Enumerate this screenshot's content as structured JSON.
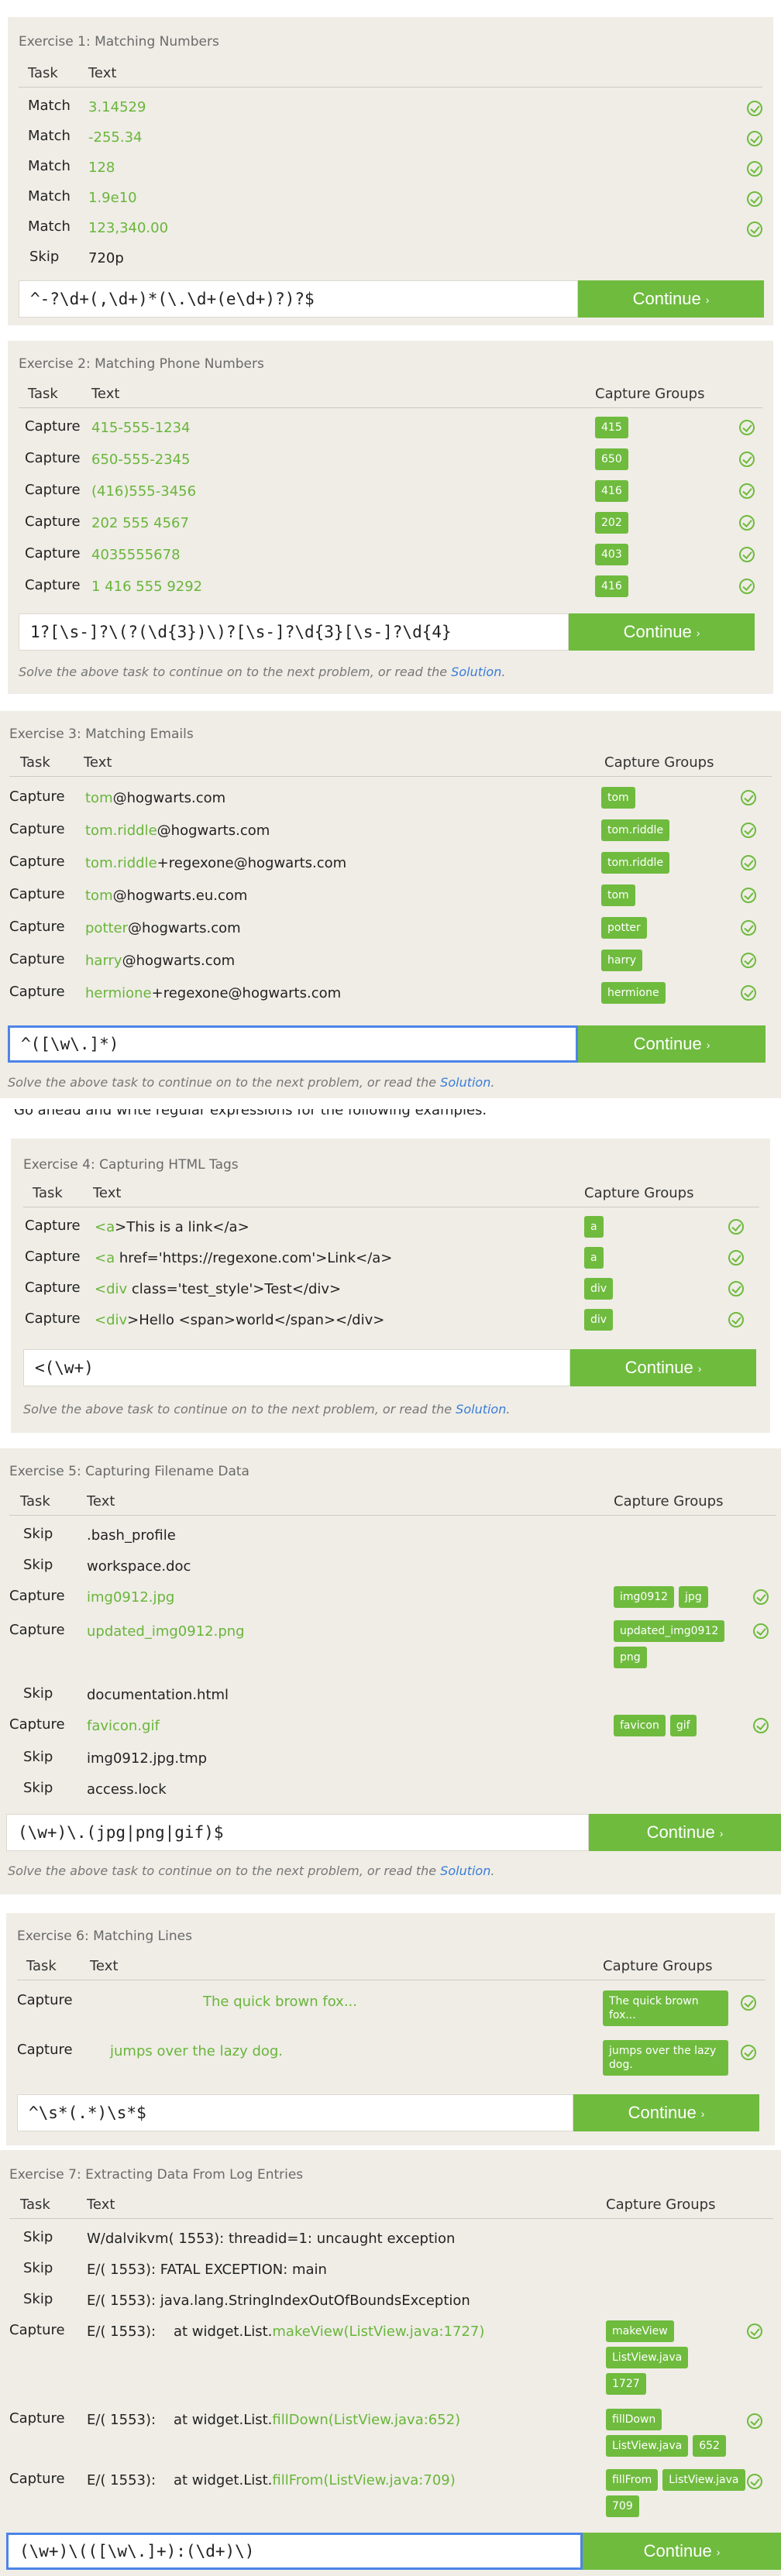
{
  "headers": {
    "task": "Task",
    "text": "Text",
    "capture_groups": "Capture Groups"
  },
  "continue_label": "Continue",
  "continue_arrow": "›",
  "solve_prefix": "Solve the above task to continue on to the next problem, or read the ",
  "solve_link": "Solution",
  "solve_suffix": ".",
  "intro_text": "Go ahead and write regular expressions for the following examples.",
  "colors": {
    "accent": "#6fbb3e",
    "panel": "#efede6",
    "link": "#3b7dd8",
    "focus": "#4d84e8"
  },
  "ex1": {
    "title": "Exercise 1: Matching Numbers",
    "regex": "^-?\\d+(,\\d+)*(\\.\\d+(e\\d+)?)?$",
    "rows": [
      {
        "task": "Match",
        "text": "3.14529"
      },
      {
        "task": "Match",
        "text": "-255.34"
      },
      {
        "task": "Match",
        "text": "128"
      },
      {
        "task": "Match",
        "text": "1.9e10"
      },
      {
        "task": "Match",
        "text": "123,340.00"
      },
      {
        "task": "Skip",
        "text": "720p"
      }
    ]
  },
  "ex2": {
    "title": "Exercise 2: Matching Phone Numbers",
    "regex": "1?[\\s-]?\\(?(\\d{3})\\)?[\\s-]?\\d{3}[\\s-]?\\d{4}",
    "rows": [
      {
        "task": "Capture",
        "text": "415-555-1234",
        "groups": [
          "415"
        ]
      },
      {
        "task": "Capture",
        "text": "650-555-2345",
        "groups": [
          "650"
        ]
      },
      {
        "task": "Capture",
        "text": "(416)555-3456",
        "groups": [
          "416"
        ]
      },
      {
        "task": "Capture",
        "text": "202 555 4567",
        "groups": [
          "202"
        ]
      },
      {
        "task": "Capture",
        "text": "4035555678",
        "groups": [
          "403"
        ]
      },
      {
        "task": "Capture",
        "text": "1 416 555 9292",
        "groups": [
          "416"
        ]
      }
    ]
  },
  "ex3": {
    "title": "Exercise 3: Matching Emails",
    "regex": "^([\\w\\.]*)",
    "rows": [
      {
        "task": "Capture",
        "hl": "tom",
        "rest": "@hogwarts.com",
        "groups": [
          "tom"
        ]
      },
      {
        "task": "Capture",
        "hl": "tom.riddle",
        "rest": "@hogwarts.com",
        "groups": [
          "tom.riddle"
        ]
      },
      {
        "task": "Capture",
        "hl": "tom.riddle",
        "rest": "+regexone@hogwarts.com",
        "groups": [
          "tom.riddle"
        ]
      },
      {
        "task": "Capture",
        "hl": "tom",
        "rest": "@hogwarts.eu.com",
        "groups": [
          "tom"
        ]
      },
      {
        "task": "Capture",
        "hl": "potter",
        "rest": "@hogwarts.com",
        "groups": [
          "potter"
        ]
      },
      {
        "task": "Capture",
        "hl": "harry",
        "rest": "@hogwarts.com",
        "groups": [
          "harry"
        ]
      },
      {
        "task": "Capture",
        "hl": "hermione",
        "rest": "+regexone@hogwarts.com",
        "groups": [
          "hermione"
        ]
      }
    ]
  },
  "ex4": {
    "title": "Exercise 4: Capturing HTML Tags",
    "regex": "<(\\w+)",
    "rows": [
      {
        "task": "Capture",
        "hl": "<a",
        "rest": ">This is a link</a>",
        "groups": [
          "a"
        ]
      },
      {
        "task": "Capture",
        "hl": "<a",
        "rest": " href='https://regexone.com'>Link</a>",
        "groups": [
          "a"
        ]
      },
      {
        "task": "Capture",
        "hl": "<div",
        "rest": " class='test_style'>Test</div>",
        "groups": [
          "div"
        ]
      },
      {
        "task": "Capture",
        "hl": "<div",
        "rest": ">Hello <span>world</span></div>",
        "groups": [
          "div"
        ]
      }
    ]
  },
  "ex5": {
    "title": "Exercise 5: Capturing Filename Data",
    "regex": "(\\w+)\\.(jpg|png|gif)$",
    "rows": [
      {
        "task": "Skip",
        "text": ".bash_profile"
      },
      {
        "task": "Skip",
        "text": "workspace.doc"
      },
      {
        "task": "Capture",
        "hl": "img0912.jpg",
        "groups": [
          "img0912",
          "jpg"
        ]
      },
      {
        "task": "Capture",
        "hl": "updated_img0912.png",
        "groups": [
          "updated_img0912",
          "png"
        ]
      },
      {
        "task": "Skip",
        "text": "documentation.html"
      },
      {
        "task": "Capture",
        "hl": "favicon.gif",
        "groups": [
          "favicon",
          "gif"
        ]
      },
      {
        "task": "Skip",
        "text": "img0912.jpg.tmp"
      },
      {
        "task": "Skip",
        "text": "access.lock"
      }
    ]
  },
  "ex6": {
    "title": "Exercise 6: Matching Lines",
    "regex": "^\\s*(.*)\\s*$",
    "rows": [
      {
        "task": "Capture",
        "hl": "The quick brown fox...",
        "groups": [
          "The quick brown fox..."
        ]
      },
      {
        "task": "Capture",
        "hl": "jumps over the lazy dog.",
        "groups": [
          "jumps over the lazy dog."
        ]
      }
    ]
  },
  "ex7": {
    "title": "Exercise 7: Extracting Data From Log Entries",
    "regex": "(\\w+)\\(([\\w\\.]+):(\\d+)\\)",
    "rows": [
      {
        "task": "Skip",
        "text": "W/dalvikvm( 1553): threadid=1: uncaught exception"
      },
      {
        "task": "Skip",
        "text": "E/( 1553): FATAL EXCEPTION: main"
      },
      {
        "task": "Skip",
        "text": "E/( 1553): java.lang.StringIndexOutOfBoundsException"
      },
      {
        "task": "Capture",
        "pre": "E/( 1553):    at widget.List.",
        "hl": "makeView(ListView.java:1727)",
        "groups": [
          "makeView",
          "ListView.java",
          "1727"
        ]
      },
      {
        "task": "Capture",
        "pre": "E/( 1553):    at widget.List.",
        "hl": "fillDown(ListView.java:652)",
        "groups": [
          "fillDown",
          "ListView.java",
          "652"
        ]
      },
      {
        "task": "Capture",
        "pre": "E/( 1553):    at widget.List.",
        "hl": "fillFrom(ListView.java:709)",
        "groups": [
          "fillFrom",
          "ListView.java",
          "709"
        ]
      }
    ]
  }
}
